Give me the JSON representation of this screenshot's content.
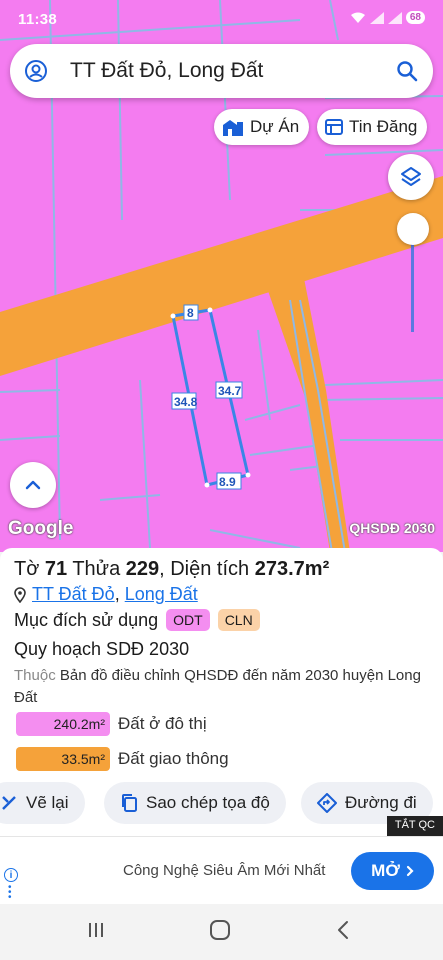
{
  "status_bar": {
    "time": "11:38",
    "battery": "68",
    "icons": [
      "wifi-icon",
      "signal-icon",
      "signal-icon"
    ]
  },
  "search": {
    "text": "TT Đất Đỏ, Long Đất",
    "left_icon": "user-circle-icon",
    "right_icon": "search-icon"
  },
  "chips": {
    "du_an": "Dự Án",
    "tin_dang": "Tin Đăng"
  },
  "map": {
    "google_logo": "Google",
    "layer_name": "QHSDĐ 2030",
    "edge_labels": {
      "top": "8",
      "left": "34.8",
      "right": "34.7",
      "bottom": "8.9"
    },
    "colors": {
      "residential_land": "#f47cf0",
      "road_land": "#f5a23a",
      "parcel_outline": "#3a86e6",
      "boundary_lines": "#8fb8e6"
    }
  },
  "info": {
    "title": {
      "sheet_prefix": "Tờ ",
      "sheet_no": "71",
      "parcel_prefix": " Thửa ",
      "parcel_no": "229",
      "area_prefix": ", Diện tích ",
      "area": "273.7m²"
    },
    "location": {
      "town": "TT Đất Đỏ",
      "separator": ", ",
      "district": "Long Đất"
    },
    "purpose_label": "Mục đích sử dụng",
    "tags": [
      "ODT",
      "CLN"
    ],
    "plan_title": "Quy hoạch SDĐ 2030",
    "plan_prefix": "Thuộc",
    "plan_desc": " Bản đồ điều chỉnh QHSDĐ đến năm 2030 huyện Long Đất",
    "areas": [
      {
        "value": "240.2m²",
        "label": "Đất ở đô thị",
        "color": "#f48ef0"
      },
      {
        "value": "33.5m²",
        "label": "Đất giao thông",
        "color": "#f5a23a"
      }
    ]
  },
  "actions": {
    "redraw": "Vẽ lại",
    "copy_coords": "Sao chép tọa độ",
    "directions": "Đường đi"
  },
  "ad": {
    "close_label": "TẮT QC",
    "text": "Công Nghệ Siêu Âm Mới Nhất",
    "cta": "MỞ"
  }
}
